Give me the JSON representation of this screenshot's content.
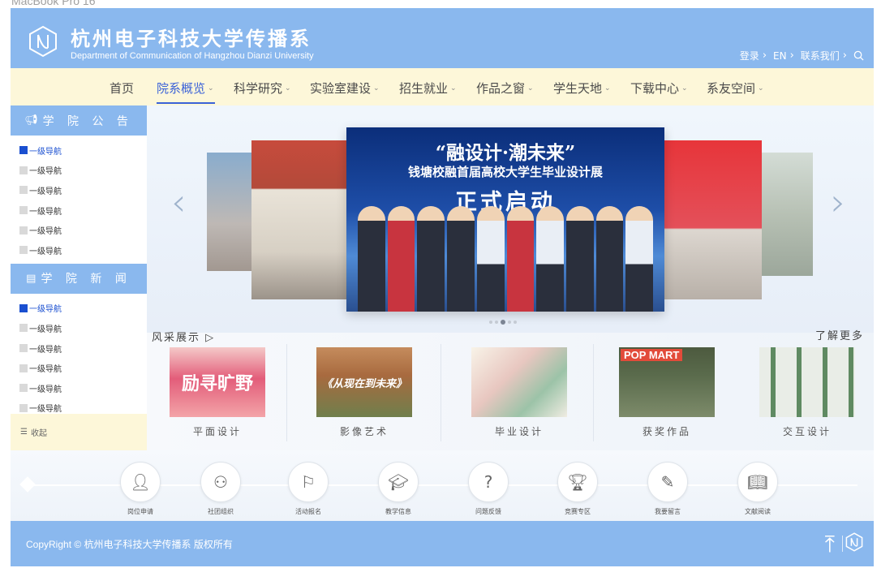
{
  "top_caption": "MacBook Pro 16\"",
  "header": {
    "title": "杭州电子科技大学传播系",
    "subtitle": "Department of Communication of Hangzhou Dianzi University",
    "links": [
      "登录",
      "EN",
      "联系我们"
    ]
  },
  "nav": {
    "items": [
      "首页",
      "院系概览",
      "科学研究",
      "实验室建设",
      "招生就业",
      "作品之窗",
      "学生天地",
      "下载中心",
      "系友空间"
    ],
    "active": "院系概览"
  },
  "sidebar": {
    "announcements": {
      "title": "学 院 公 告",
      "items": [
        "一级导航",
        "一级导航",
        "一级导航",
        "一级导航",
        "一级导航",
        "一级导航"
      ]
    },
    "news": {
      "title": "学 院 新 闻",
      "items": [
        "一级导航",
        "一级导航",
        "一级导航",
        "一级导航",
        "一级导航",
        "一级导航"
      ]
    },
    "collapse_label": "收起"
  },
  "carousel": {
    "main_line1": "“融设计·潮未来”",
    "main_line2": "钱塘校融首届高校大学生毕业设计展",
    "main_line3": "正式启动",
    "dot_count": 5,
    "active_dot": 2
  },
  "gallery": {
    "title": "风采展示 ▷",
    "more": "了解更多",
    "items": [
      {
        "caption": "平面设计",
        "image_text": "励寻旷野"
      },
      {
        "caption": "影像艺术",
        "image_text": "《从现在到未来》"
      },
      {
        "caption": "毕业设计",
        "image_text": ""
      },
      {
        "caption": "获奖作品",
        "image_text": "POP MART"
      },
      {
        "caption": "交互设计",
        "image_text": ""
      }
    ]
  },
  "services": [
    {
      "label": "岗位申请",
      "icon": "user-icon"
    },
    {
      "label": "社团组织",
      "icon": "group-icon"
    },
    {
      "label": "活动报名",
      "icon": "flag-icon"
    },
    {
      "label": "教学信息",
      "icon": "graduation-cap-icon"
    },
    {
      "label": "问题反馈",
      "icon": "question-icon"
    },
    {
      "label": "竞赛专区",
      "icon": "trophy-icon"
    },
    {
      "label": "我要留言",
      "icon": "edit-note-icon"
    },
    {
      "label": "文献阅读",
      "icon": "book-icon"
    }
  ],
  "footer": {
    "copyright": "CopyRight © 杭州电子科技大学传播系 版权所有"
  }
}
